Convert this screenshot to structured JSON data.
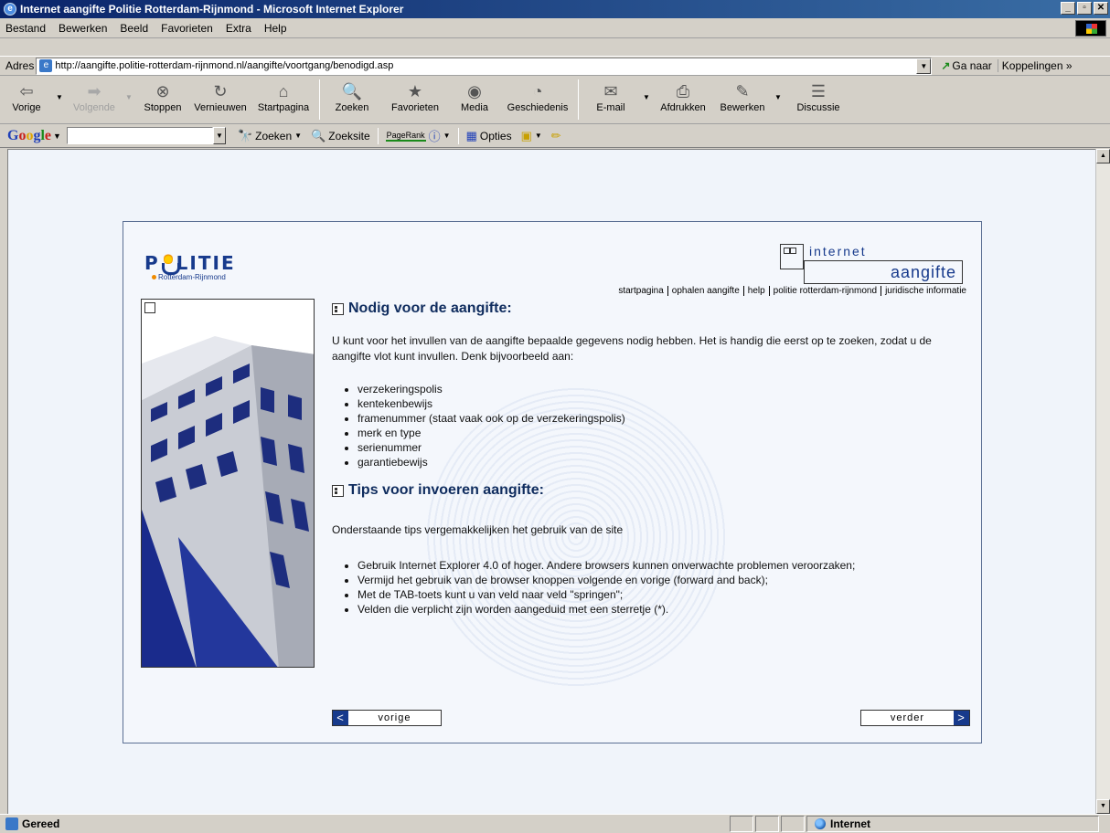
{
  "window": {
    "title": "Internet aangifte Politie Rotterdam-Rijnmond - Microsoft Internet Explorer",
    "min_label": "_",
    "max_label": "▫",
    "close_label": "✕"
  },
  "menu": [
    "Bestand",
    "Bewerken",
    "Beeld",
    "Favorieten",
    "Extra",
    "Help"
  ],
  "address": {
    "label": "Adres",
    "url": "http://aangifte.politie-rotterdam-rijnmond.nl/aangifte/voortgang/benodigd.asp",
    "go_label": "Ga naar",
    "links_label": "Koppelingen"
  },
  "toolbar": [
    {
      "label": "Vorige",
      "icon": "⇦",
      "disabled": false,
      "dropdown": true
    },
    {
      "label": "Volgende",
      "icon": "➡",
      "disabled": true,
      "dropdown": true
    },
    {
      "label": "Stoppen",
      "icon": "⊗",
      "disabled": false
    },
    {
      "label": "Vernieuwen",
      "icon": "↻",
      "disabled": false
    },
    {
      "label": "Startpagina",
      "icon": "⌂",
      "disabled": false
    },
    {
      "label": "Zoeken",
      "icon": "🔍",
      "disabled": false
    },
    {
      "label": "Favorieten",
      "icon": "★",
      "disabled": false
    },
    {
      "label": "Media",
      "icon": "◉",
      "disabled": false
    },
    {
      "label": "Geschiedenis",
      "icon": "◔",
      "disabled": false
    },
    {
      "label": "E-mail",
      "icon": "✉",
      "disabled": false,
      "dropdown": true
    },
    {
      "label": "Afdrukken",
      "icon": "⎙",
      "disabled": false
    },
    {
      "label": "Bewerken",
      "icon": "✎",
      "disabled": false,
      "dropdown": true
    },
    {
      "label": "Discussie",
      "icon": "☰",
      "disabled": false
    }
  ],
  "google_bar": {
    "logo": "Google",
    "search_label": "Zoeken",
    "site_search_label": "Zoeksite",
    "pagerank_label": "PageRank",
    "options_label": "Opties"
  },
  "page": {
    "logo_main": "P  LITIE",
    "logo_sub": "Rotterdam-Rijnmond",
    "brand_top": "internet",
    "brand_bottom": "aangifte",
    "nav": [
      "startpagina",
      "ophalen aangifte",
      "help",
      "politie rotterdam-rijnmond",
      "juridische informatie"
    ],
    "section1": {
      "title": "Nodig voor de aangifte:",
      "intro": "U kunt voor het invullen van de aangifte bepaalde gegevens nodig hebben. Het is handig die eerst op te zoeken, zodat u de aangifte vlot kunt invullen. Denk bijvoorbeeld aan:",
      "items": [
        "verzekeringspolis",
        "kentekenbewijs",
        "framenummer (staat vaak ook op de verzekeringspolis)",
        "merk en type",
        "serienummer",
        "garantiebewijs"
      ]
    },
    "section2": {
      "title": "Tips voor invoeren aangifte:",
      "intro": "Onderstaande tips vergemakkelijken het gebruik van de site",
      "items": [
        "Gebruik Internet Explorer 4.0 of hoger. Andere browsers kunnen onverwachte problemen veroorzaken;",
        "Vermijd het gebruik van de browser knoppen volgende en vorige (forward and back);",
        "Met de TAB-toets kunt u van veld naar veld \"springen\";",
        "Velden die verplicht zijn worden aangeduid met een sterretje (*)."
      ]
    },
    "prev_label": "vorige",
    "prev_arrow": "<",
    "next_label": "verder",
    "next_arrow": ">"
  },
  "status": {
    "text": "Gereed",
    "zone": "Internet"
  },
  "colors": {
    "accent": "#173a8c",
    "titlebar": "#0a246a",
    "page_bg": "#f0f4fa"
  }
}
